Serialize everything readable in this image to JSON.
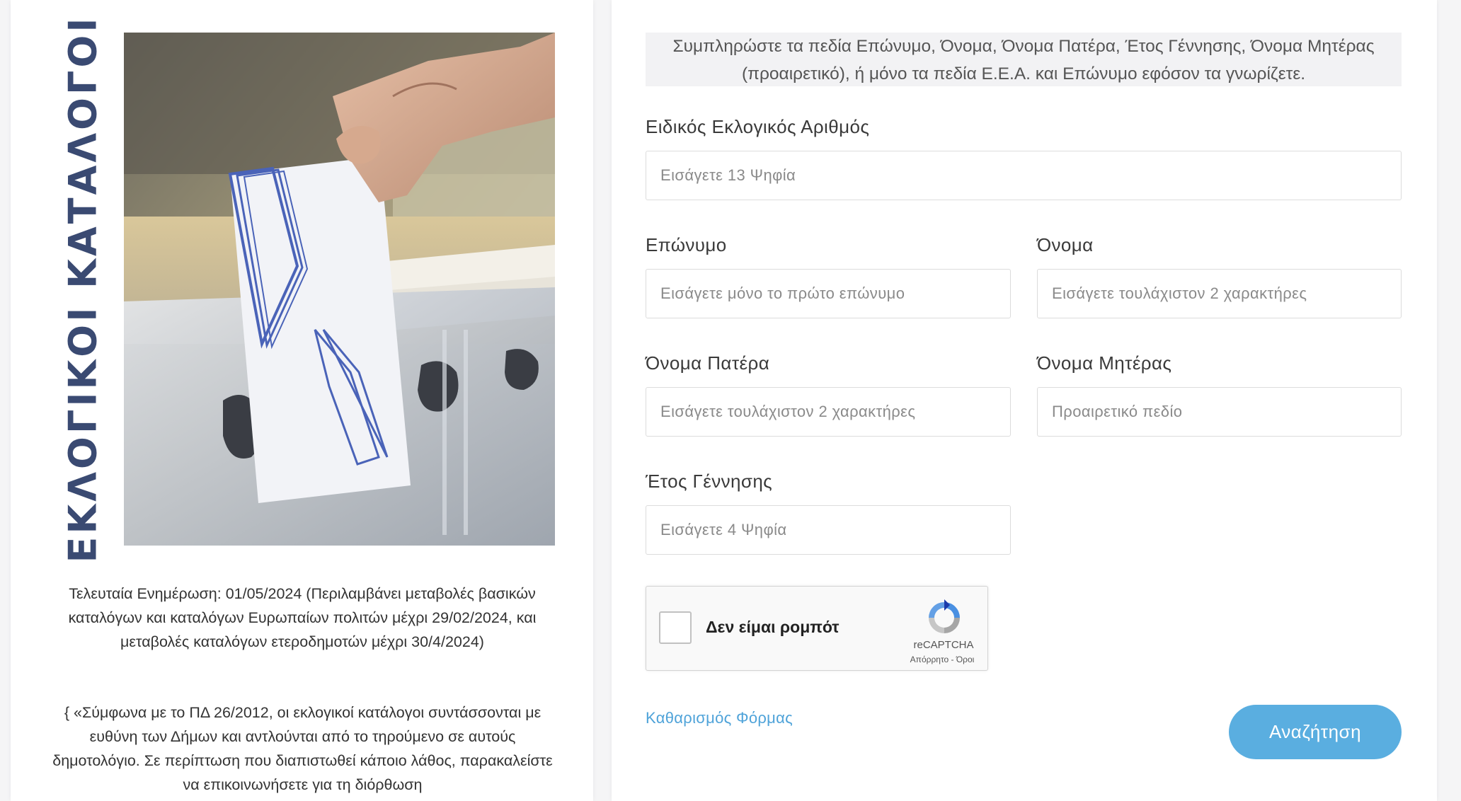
{
  "sidebar": {
    "vertical_title": "ΕΚΛΟΓΙΚΟΙ ΚΑΤΑΛΟΓΟΙ",
    "update_text": "Τελευταία Ενημέρωση: 01/05/2024 (Περιλαμβάνει μεταβολές βασικών καταλόγων και καταλόγων Ευρωπαίων πολιτών μέχρι 29/02/2024, και μεταβολές καταλόγων ετεροδημοτών μέχρι 30/4/2024)",
    "note_text": "{ «Σύμφωνα με το ΠΔ 26/2012, οι εκλογικοί κατάλογοι συντάσσονται με ευθύνη των Δήμων και αντλούνται από το τηρούμενο σε αυτούς δημοτολόγιο. Σε περίπτωση που διαπιστωθεί κάποιο λάθος, παρακαλείστε να επικοινωνήσετε για τη διόρθωση"
  },
  "form": {
    "instructions": "Συμπληρώστε τα πεδία Επώνυμο, Όνομα, Όνομα Πατέρα, Έτος Γέννησης, Όνομα Μητέρας (προαιρετικό), ή μόνο τα πεδία Ε.Ε.Α. και Επώνυμο εφόσον τα γνωρίζετε.",
    "eea": {
      "label": "Ειδικός Εκλογικός Αριθμός",
      "placeholder": "Εισάγετε 13 Ψηφία",
      "value": ""
    },
    "surname": {
      "label": "Επώνυμο",
      "placeholder": "Εισάγετε μόνο το πρώτο επώνυμο",
      "value": ""
    },
    "first_name": {
      "label": "Όνομα",
      "placeholder": "Εισάγετε τουλάχιστον 2 χαρακτήρες",
      "value": ""
    },
    "father_name": {
      "label": "Όνομα Πατέρα",
      "placeholder": "Εισάγετε τουλάχιστον 2 χαρακτήρες",
      "value": ""
    },
    "mother_name": {
      "label": "Όνομα Μητέρας",
      "placeholder": "Προαιρετικό πεδίο",
      "value": ""
    },
    "birth_year": {
      "label": "Έτος Γέννησης",
      "placeholder": "Εισάγετε 4 Ψηφία",
      "value": ""
    },
    "captcha": {
      "label": "Δεν είμαι ρομπότ",
      "brand": "reCAPTCHA",
      "links": "Απόρρητο - Όροι",
      "icon": "recaptcha-icon",
      "checked": false
    },
    "clear_label": "Καθαρισμός Φόρμας",
    "search_label": "Αναζήτηση"
  },
  "colors": {
    "title": "#3a4a72",
    "accent": "#5aaee0",
    "link": "#4fa3d9"
  }
}
